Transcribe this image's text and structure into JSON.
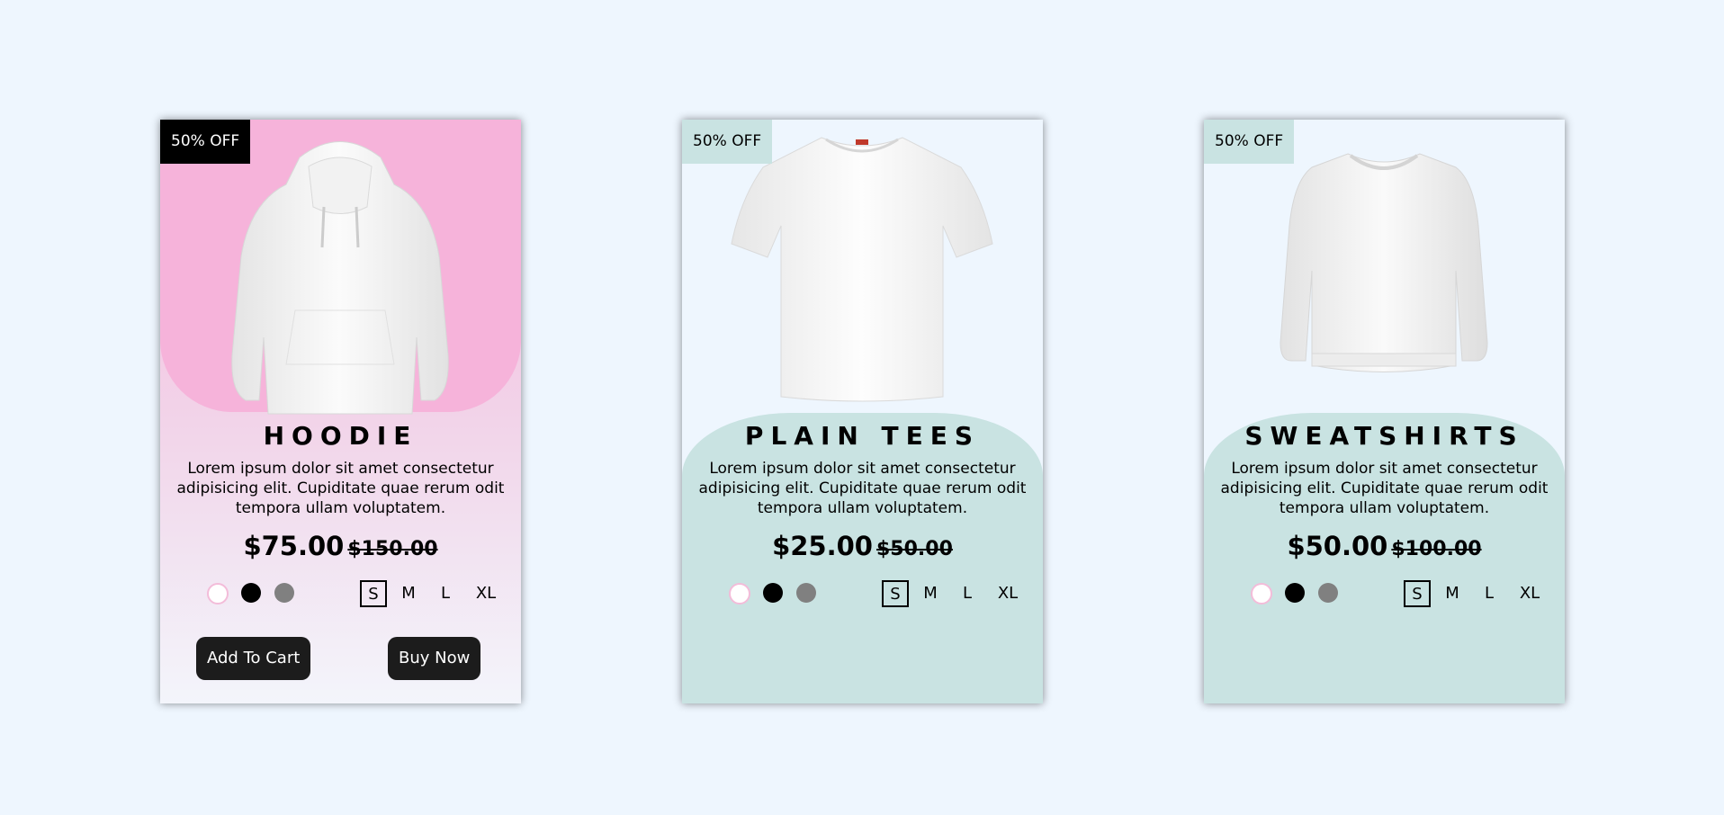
{
  "cards": [
    {
      "badge": "50% OFF",
      "title": "HOODIE",
      "description": "Lorem ipsum dolor sit amet consectetur adipisicing elit. Cupiditate quae rerum odit tempora ullam voluptatem.",
      "price": "$75.00",
      "old_price": "$150.00",
      "colors": [
        "#ffffff",
        "#000000",
        "#808080"
      ],
      "sizes": [
        "S",
        "M",
        "L",
        "XL"
      ],
      "selected_size": "S",
      "add_to_cart_label": "Add To Cart",
      "buy_now_label": "Buy Now"
    },
    {
      "badge": "50% OFF",
      "title": "PLAIN TEES",
      "description": "Lorem ipsum dolor sit amet consectetur adipisicing elit. Cupiditate quae rerum odit tempora ullam voluptatem.",
      "price": "$25.00",
      "old_price": "$50.00",
      "colors": [
        "#ffffff",
        "#000000",
        "#808080"
      ],
      "sizes": [
        "S",
        "M",
        "L",
        "XL"
      ],
      "selected_size": "S"
    },
    {
      "badge": "50% OFF",
      "title": "SWEATSHIRTS",
      "description": "Lorem ipsum dolor sit amet consectetur adipisicing elit. Cupiditate quae rerum odit tempora ullam voluptatem.",
      "price": "$50.00",
      "old_price": "$100.00",
      "colors": [
        "#ffffff",
        "#000000",
        "#808080"
      ],
      "sizes": [
        "S",
        "M",
        "L",
        "XL"
      ],
      "selected_size": "S"
    }
  ],
  "theme": {
    "page_background": "#eef6fe",
    "hoodie_accent": "#f6b3da",
    "teal_accent": "#c9e3e2",
    "button_color": "#1c1c1c"
  }
}
